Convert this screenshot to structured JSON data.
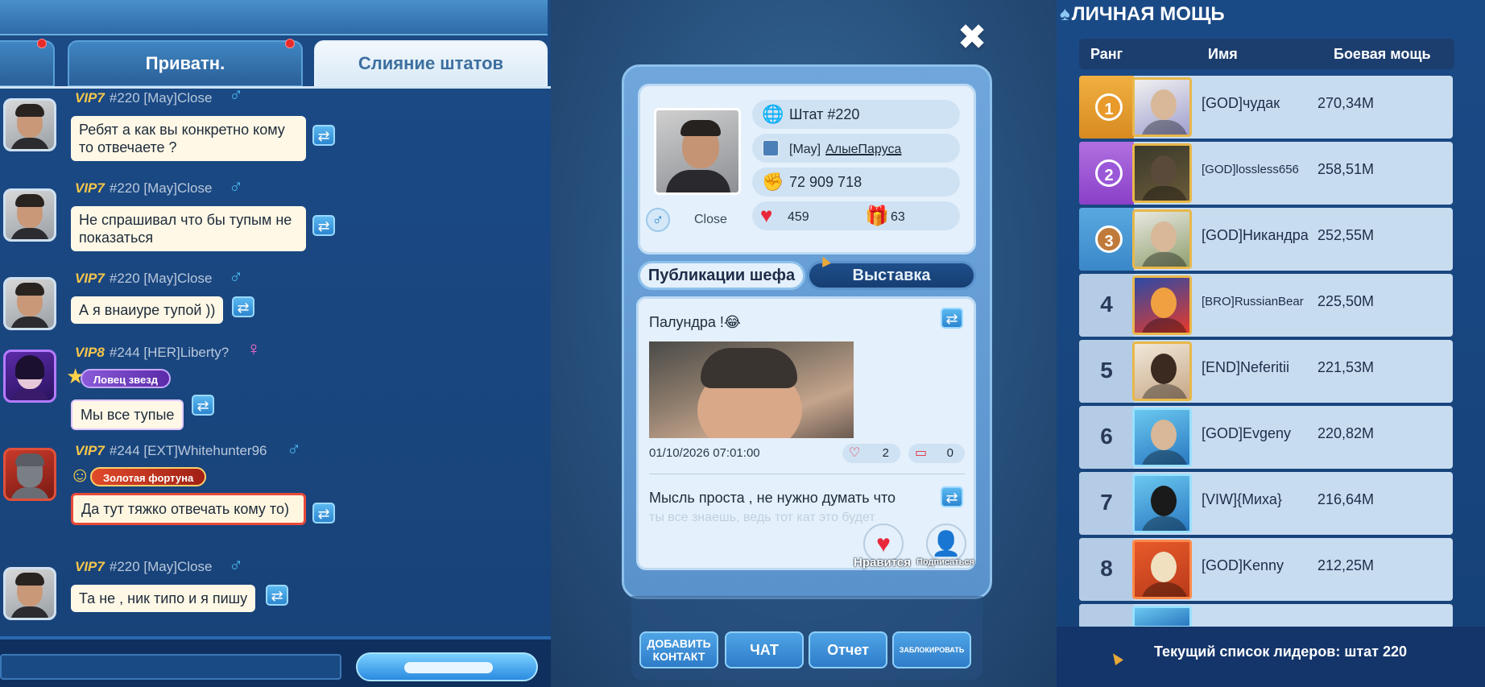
{
  "chat": {
    "tabs": [
      {
        "label": ""
      },
      {
        "label": "Приватн."
      },
      {
        "label": "Слияние штатов"
      }
    ],
    "messages": [
      {
        "vip": "VIP7",
        "user": "#220 [May]Close",
        "text": "Ребят а как вы конкретно кому то отвечаете ?",
        "gender": "♂"
      },
      {
        "vip": "VIP7",
        "user": "#220 [May]Close",
        "text": "Не спрашивал что бы тупым не показаться",
        "gender": "♂"
      },
      {
        "vip": "VIP7",
        "user": "#220 [May]Close",
        "text": "А я внаиуре тупой ))",
        "gender": "♂"
      },
      {
        "vip": "VIP8",
        "user": "#244 [HER]Liberty?",
        "text": "Мы все тупые",
        "gender": "♀",
        "badge": "Ловец звезд"
      },
      {
        "vip": "VIP7",
        "user": "#244 [EXT]Whitehunter96",
        "text": "Да тут тяжко отвечать кому то)",
        "gender": "♂",
        "badge": "Золотая фортуна"
      },
      {
        "vip": "VIP7",
        "user": "#220 [May]Close",
        "text": "Та не , ник типо и я пишу",
        "gender": "♂"
      }
    ],
    "translate_icon": "⇄"
  },
  "profile": {
    "close_icon": "✖",
    "name": "Close",
    "gender": "♂",
    "state": "Штат #220",
    "guild_tag": "[May]",
    "alliance": "АлыеПаруса",
    "power": "72 909 718",
    "likes": "459",
    "gifts": "63",
    "tabs": {
      "posts": "Публикации шефа",
      "exhibit": "Выставка"
    },
    "post": {
      "title": "Палундра !😂",
      "date": "01/10/2026 07:01:00",
      "likes": "2",
      "comments": "0"
    },
    "post2": {
      "text": "Мысль проста , не нужно думать что",
      "text_faded": "ты все знаешь, ведь тот кат это будет"
    },
    "like_label": "Нравится",
    "subscribe_label": "Подписаться",
    "actions": {
      "add_contact": "ДОБАВИТЬ КОНТАКТ",
      "chat": "ЧАТ",
      "report": "Отчет",
      "block": "ЗАБЛОКИРОВАТЬ"
    }
  },
  "leaderboard": {
    "title": "ЛИЧНАЯ МОЩЬ",
    "columns": {
      "rank": "Ранг",
      "name": "Имя",
      "power": "Боевая мощь"
    },
    "rows": [
      {
        "rank": "1",
        "name": "[GOD]чудак",
        "power": "270,34M"
      },
      {
        "rank": "2",
        "name": "[GOD]lossless656",
        "power": "258,51M"
      },
      {
        "rank": "3",
        "name": "[GOD]Никандра",
        "power": "252,55M"
      },
      {
        "rank": "4",
        "name": "[BRO]RussianBear",
        "power": "225,50M"
      },
      {
        "rank": "5",
        "name": "[END]Neferitii",
        "power": "221,53M"
      },
      {
        "rank": "6",
        "name": "[GOD]Evgeny",
        "power": "220,82M"
      },
      {
        "rank": "7",
        "name": "[VIW]{Миха}",
        "power": "216,64M"
      },
      {
        "rank": "8",
        "name": "[GOD]Kenny",
        "power": "212,25M"
      }
    ],
    "footer": "Текущий список лидеров: штат 220"
  }
}
